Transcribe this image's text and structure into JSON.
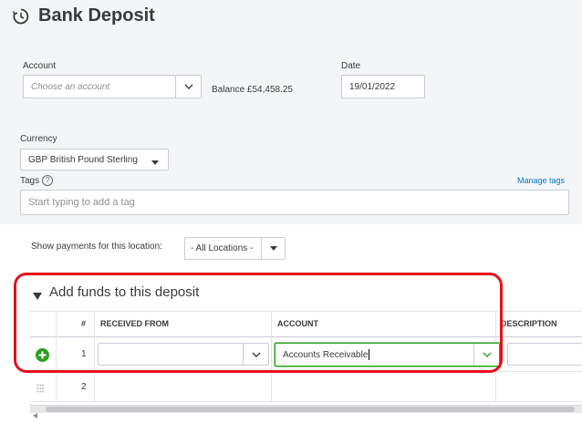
{
  "page": {
    "title": "Bank Deposit",
    "title_icon": "deposit-clock-icon"
  },
  "account": {
    "label": "Account",
    "placeholder": "Choose an account",
    "balance_text": "Balance £54,458.25"
  },
  "date": {
    "label": "Date",
    "value": "19/01/2022"
  },
  "currency": {
    "label": "Currency",
    "value": "GBP British Pound Sterling"
  },
  "tags": {
    "label": "Tags",
    "help_icon": "?",
    "manage_link": "Manage tags",
    "placeholder": "Start typing to add a tag"
  },
  "location": {
    "label": "Show payments for this location:",
    "value": "- All Locations -"
  },
  "funds": {
    "section_title": "Add funds to this deposit",
    "columns": [
      "#",
      "RECEIVED FROM",
      "ACCOUNT",
      "DESCRIPTION"
    ],
    "rows": [
      {
        "num": "1",
        "received_from": "",
        "account": "Accounts Receivable"
      },
      {
        "num": "2",
        "received_from": "",
        "account": ""
      }
    ]
  },
  "colors": {
    "accent_green": "#2ca01c",
    "highlight_red": "#e6101a",
    "link_blue": "#0077c5"
  }
}
